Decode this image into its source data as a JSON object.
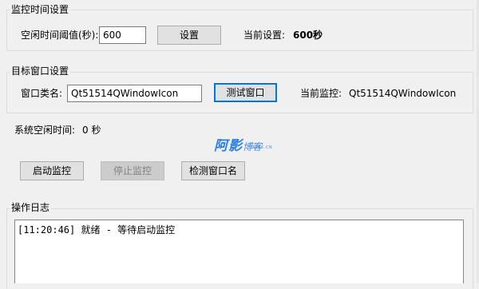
{
  "monitor_settings": {
    "title": "监控时间设置",
    "idle_threshold_label": "空闲时间阈值(秒):",
    "idle_threshold_value": "600",
    "set_button": "设置",
    "current_setting_label": "当前设置:",
    "current_setting_value": "600秒"
  },
  "target_window": {
    "title": "目标窗口设置",
    "class_name_label": "窗口类名:",
    "class_name_value": "Qt51514QWindowIcon",
    "test_button": "测试窗口",
    "current_monitor_label": "当前监控:",
    "current_monitor_value": "Qt51514QWindowIcon"
  },
  "system_idle": {
    "label": "系统空闲时间:",
    "value": "0 秒"
  },
  "watermark": {
    "main": "阿影",
    "sub": "博客",
    "tiny": "AYBK.CN",
    "color": "#2a7fe6"
  },
  "actions": {
    "start_button": "启动监控",
    "stop_button": "停止监控",
    "detect_button": "检测窗口名"
  },
  "log": {
    "title": "操作日志",
    "entries": [
      "[11:20:46] 就绪 - 等待启动监控"
    ]
  },
  "colors": {
    "focus": "#0078d7",
    "disabled_bg": "#cccccc",
    "button_bg": "#e1e1e1"
  }
}
